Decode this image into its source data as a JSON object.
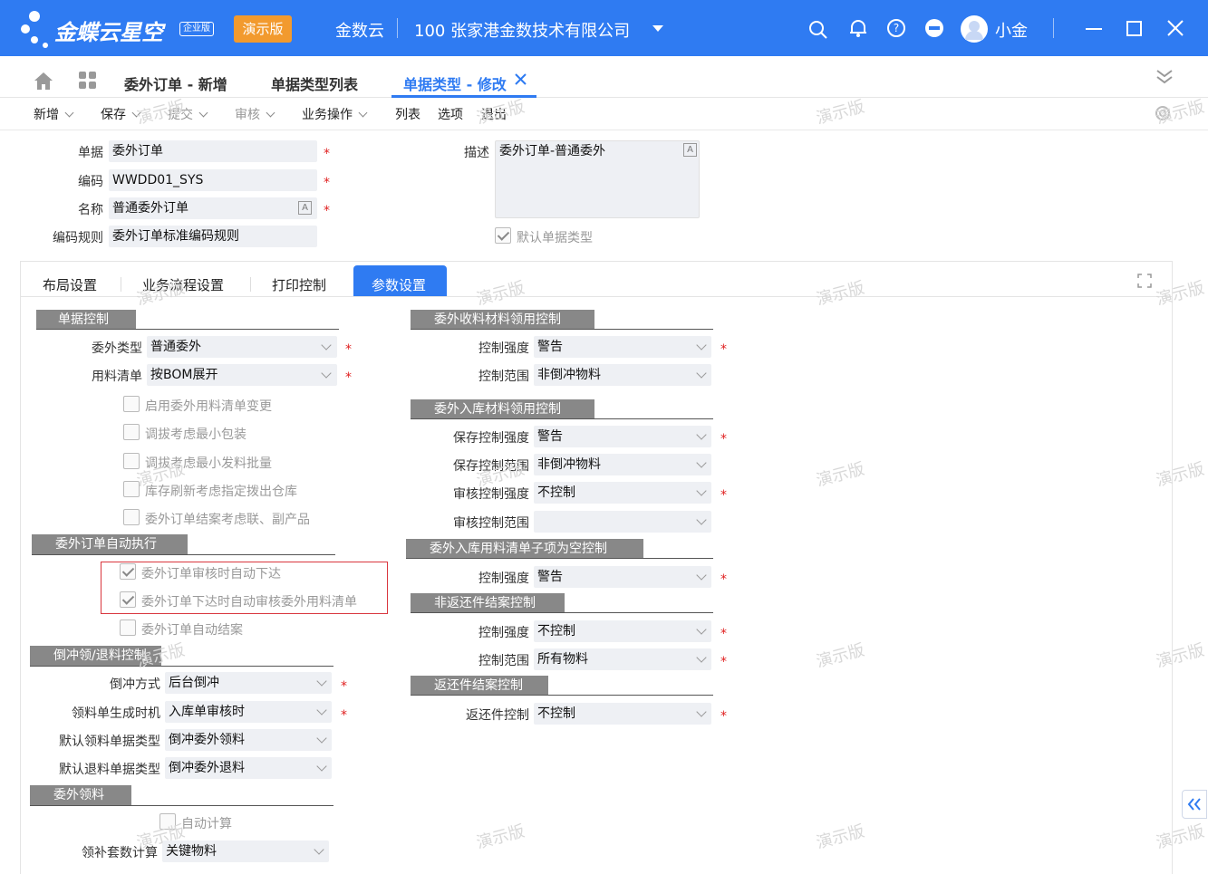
{
  "app": {
    "brand": "金蝶云星空",
    "edition_badge": "企业版",
    "demo_badge": "演示版",
    "product": "金数云",
    "org": "100  张家港金数技术有限公司",
    "user": "小金"
  },
  "tabs": [
    {
      "label": "委外订单 - 新增"
    },
    {
      "label": "单据类型列表"
    },
    {
      "label": "单据类型 - 修改"
    }
  ],
  "toolbar": {
    "new": "新增",
    "save": "保存",
    "submit": "提交",
    "audit": "审核",
    "business_ops": "业务操作",
    "list": "列表",
    "options": "选项",
    "exit": "退出"
  },
  "header": {
    "doc_label": "单据",
    "doc_value": "委外订单",
    "code_label": "编码",
    "code_value": "WWDD01_SYS",
    "name_label": "名称",
    "name_value": "普通委外订单",
    "rule_label": "编码规则",
    "rule_value": "委外订单标准编码规则",
    "desc_label": "描述",
    "desc_value": "委外订单-普通委外",
    "default_type_label": "默认单据类型"
  },
  "panel_tabs": {
    "layout": "布局设置",
    "flow": "业务流程设置",
    "print": "打印控制",
    "params": "参数设置"
  },
  "left": {
    "sec_doc_control": "单据控制",
    "outsource_type_label": "委外类型",
    "outsource_type_value": "普通委外",
    "bom_label": "用料清单",
    "bom_value": "按BOM展开",
    "cb1": "启用委外用料清单变更",
    "cb2": "调拔考虑最小包装",
    "cb3": "调拔考虑最小发料批量",
    "cb4": "库存刷新考虑指定拨出仓库",
    "cb5": "委外订单结案考虑联、副产品",
    "sec_auto": "委外订单自动执行",
    "auto1": "委外订单审核时自动下达",
    "auto2": "委外订单下达时自动审核委外用料清单",
    "auto3": "委外订单自动结案",
    "sec_backflush": "倒冲领/退料控制",
    "bf_mode_label": "倒冲方式",
    "bf_mode_value": "后台倒冲",
    "bf_time_label": "领料单生成时机",
    "bf_time_value": "入库单审核时",
    "bf_pick_label": "默认领料单据类型",
    "bf_pick_value": "倒冲委外领料",
    "bf_return_label": "默认退料单据类型",
    "bf_return_value": "倒冲委外退料",
    "sec_pick": "委外领料",
    "auto_calc": "自动计算",
    "kit_label": "领补套数计算",
    "kit_value": "关键物料"
  },
  "right": {
    "sec1": "委外收料材料领用控制",
    "s1_strength_label": "控制强度",
    "s1_strength_value": "警告",
    "s1_scope_label": "控制范围",
    "s1_scope_value": "非倒冲物料",
    "sec2": "委外入库材料领用控制",
    "s2_save_strength_label": "保存控制强度",
    "s2_save_strength_value": "警告",
    "s2_save_scope_label": "保存控制范围",
    "s2_save_scope_value": "非倒冲物料",
    "s2_audit_strength_label": "审核控制强度",
    "s2_audit_strength_value": "不控制",
    "s2_audit_scope_label": "审核控制范围",
    "s2_audit_scope_value": "",
    "sec3": "委外入库用料清单子项为空控制",
    "s3_strength_label": "控制强度",
    "s3_strength_value": "警告",
    "sec4": "非返还件结案控制",
    "s4_strength_label": "控制强度",
    "s4_strength_value": "不控制",
    "s4_scope_label": "控制范围",
    "s4_scope_value": "所有物料",
    "sec5": "返还件结案控制",
    "s5_label": "返还件控制",
    "s5_value": "不控制"
  },
  "watermark": "演示版",
  "colors": {
    "accent": "#2f7bf2",
    "badge": "#f29a2e",
    "required": "#e02020"
  }
}
